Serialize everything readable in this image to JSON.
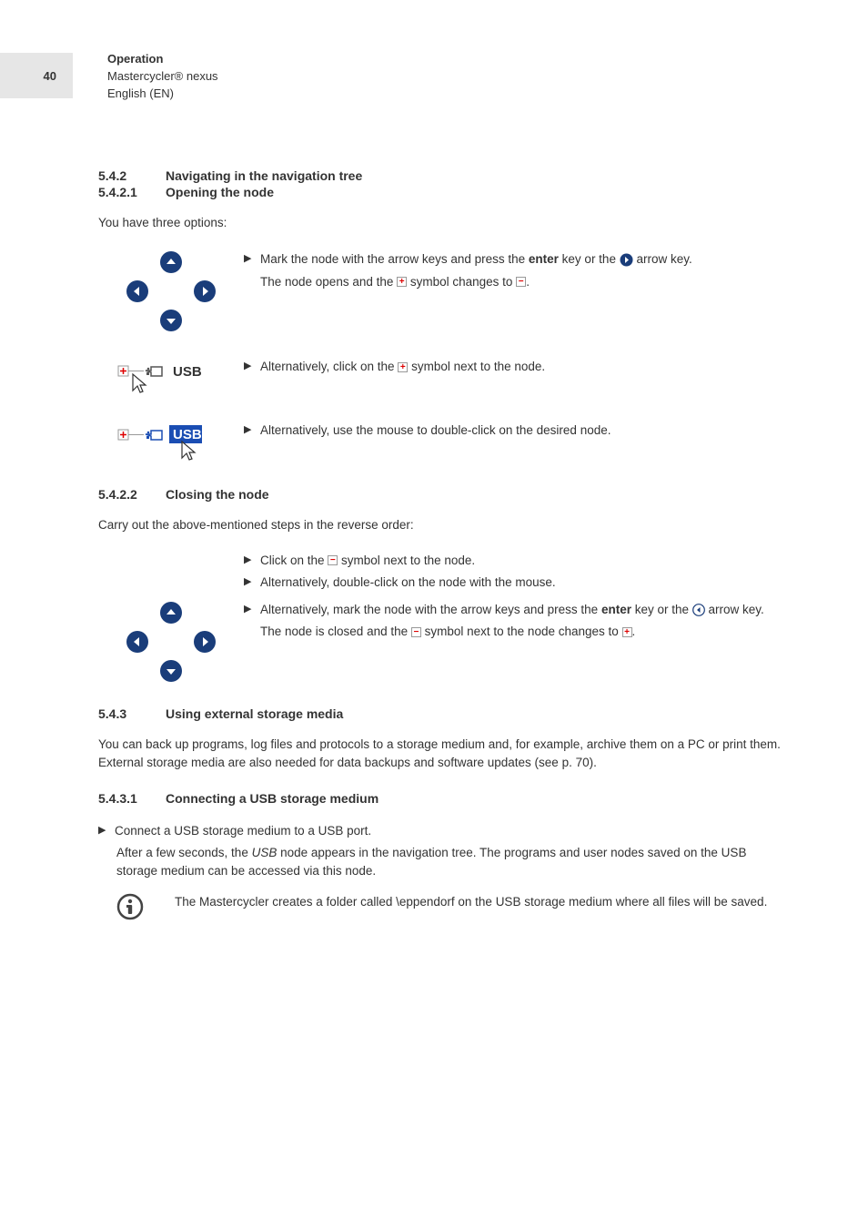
{
  "header": {
    "page_num": "40",
    "chapter": "Operation",
    "product": "Mastercycler® nexus",
    "lang": "English (EN)"
  },
  "sec_5_4_2": {
    "num": "5.4.2",
    "title": "Navigating in the navigation tree"
  },
  "sec_5_4_2_1": {
    "num": "5.4.2.1",
    "title": "Opening the node"
  },
  "intro_open": "You have three options:",
  "opt1a": "Mark the node with the arrow keys and press the ",
  "opt1_enter": "enter",
  "opt1b": " key or the ",
  "opt1c": " arrow key.",
  "opt1_line2a": "The node opens and the ",
  "opt1_line2b": " symbol changes to ",
  "opt2a": "Alternatively, click on the ",
  "opt2b": " symbol next to the node.",
  "opt3": "Alternatively, use the mouse to double-click on the desired node.",
  "usb_label": "USB",
  "sec_5_4_2_2": {
    "num": "5.4.2.2",
    "title": "Closing the node"
  },
  "intro_close": "Carry out the above-mentioned steps in the reverse order:",
  "close1a": "Click on the ",
  "close1b": " symbol next to the node.",
  "close2": "Alternatively, double-click on the node with the mouse.",
  "close3a": "Alternatively, mark the node with the arrow keys and press the ",
  "close3_enter": "enter",
  "close3b": " key or the ",
  "close3c": " arrow key.",
  "close3_line2a": "The node is closed and the ",
  "close3_line2b": " symbol next to the node changes to ",
  "sec_5_4_3": {
    "num": "5.4.3",
    "title": "Using external storage media"
  },
  "p_5_4_3": "You can back up programs, log files and protocols to a storage medium and, for example, archive them on a PC or print them. External storage media are also needed for data backups and software updates (see p. 70).",
  "sec_5_4_3_1": {
    "num": "5.4.3.1",
    "title": "Connecting a USB storage medium"
  },
  "usb_step": "Connect a USB storage medium to a USB port.",
  "usb_result1": "After a few seconds, the ",
  "usb_result_italic": "USB",
  "usb_result2": " node appears in the navigation tree. The programs and user nodes saved on the USB storage medium can be accessed via this node.",
  "info_note": "The Mastercycler creates a folder called \\eppendorf on the USB storage medium where all files will be saved."
}
